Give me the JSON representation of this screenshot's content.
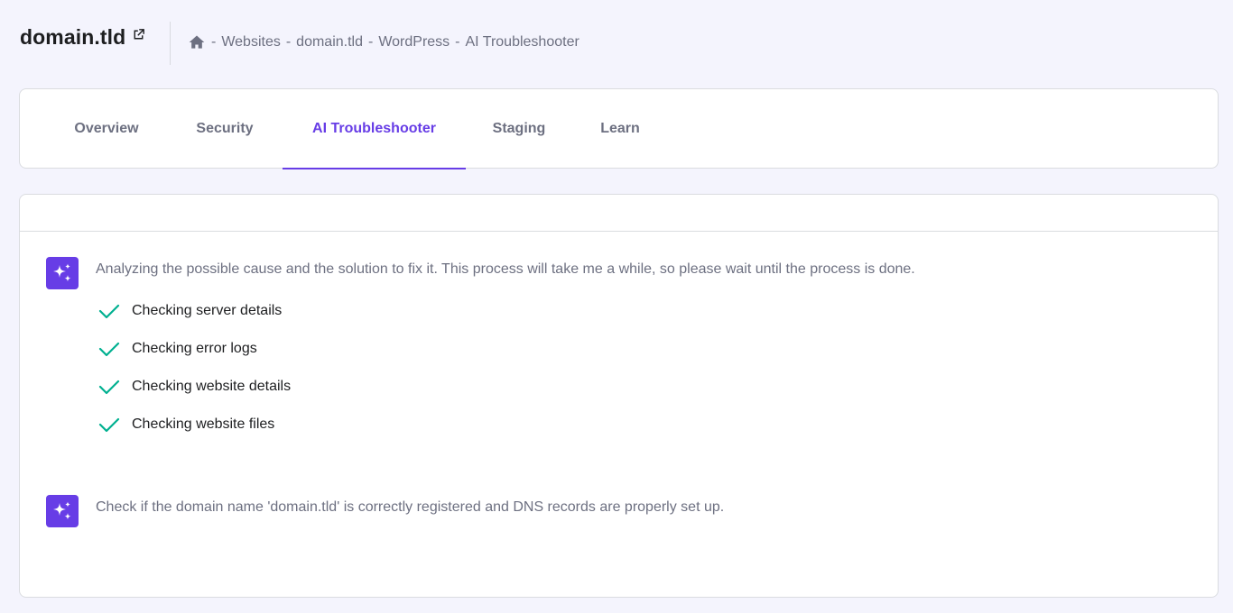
{
  "header": {
    "site_title": "domain.tld",
    "breadcrumb": [
      {
        "separator": "-",
        "label": "Websites"
      },
      {
        "separator": "-",
        "label": "domain.tld"
      },
      {
        "separator": "-",
        "label": "WordPress"
      },
      {
        "separator": "-",
        "label": "AI Troubleshooter"
      }
    ]
  },
  "tabs": [
    {
      "label": "Overview"
    },
    {
      "label": "Security"
    },
    {
      "label": "AI Troubleshooter",
      "active": true
    },
    {
      "label": "Staging"
    },
    {
      "label": "Learn"
    }
  ],
  "troubleshooter": {
    "analysis_message": "Analyzing the possible cause and the solution to fix it. This process will take me a while, so please wait until the process is done.",
    "checks": [
      {
        "label": "Checking server details",
        "status": "done"
      },
      {
        "label": "Checking error logs",
        "status": "done"
      },
      {
        "label": "Checking website details",
        "status": "done"
      },
      {
        "label": "Checking website files",
        "status": "done"
      }
    ],
    "result_message": "Check if the domain name 'domain.tld' is correctly registered and DNS records are properly set up."
  },
  "colors": {
    "accent": "#673de6",
    "check": "#00b090",
    "background": "#f4f4fd"
  },
  "icons": [
    "external-link-icon",
    "home-icon",
    "ai-sparkles-icon",
    "check-icon"
  ]
}
